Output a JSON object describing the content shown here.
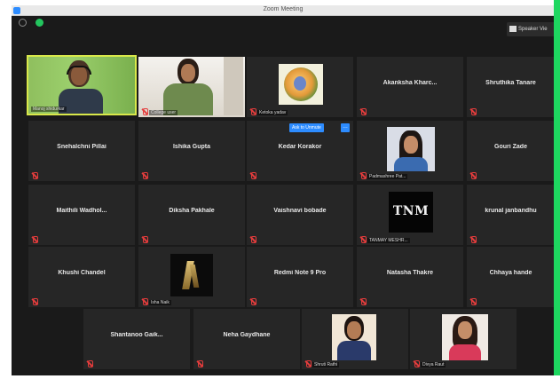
{
  "window": {
    "title": "Zoom Meeting"
  },
  "toolbar": {
    "speaker_view_label": "Speaker Vie"
  },
  "kedar_tile_buttons": {
    "pin_label": "Ask to Unmute",
    "more_label": "…"
  },
  "participants": {
    "r1": [
      {
        "label": "Manoj shidurkar"
      },
      {
        "label": "College user"
      },
      {
        "label": "Ketoka yadav"
      },
      {
        "name": "Akanksha Kharc..."
      },
      {
        "name": "Shruthika Tanare"
      }
    ],
    "r2": [
      {
        "name": "Snehalchni Pillai"
      },
      {
        "name": "Ishika Gupta"
      },
      {
        "name": "Kedar Korakor"
      },
      {
        "label": "Padmashree Pat..."
      },
      {
        "name": "Gouri Zade"
      }
    ],
    "r3": [
      {
        "name": "Maithili Wadhol..."
      },
      {
        "name": "Diksha Pakhale"
      },
      {
        "name": "Vaishnavi bobade"
      },
      {
        "label": "TANMAY MESHR..."
      },
      {
        "name": "krunal janbandhu"
      }
    ],
    "r4": [
      {
        "name": "Khushi Chandel"
      },
      {
        "label": "Isha Naik"
      },
      {
        "name": "Redmi Note 9 Pro"
      },
      {
        "name": "Natasha Thakre"
      },
      {
        "name": "Chhaya hande"
      }
    ],
    "r5": [
      {
        "name": "Shantanoo Gaik..."
      },
      {
        "name": "Neha Gaydhane"
      },
      {
        "label": "Shruti Rathi"
      },
      {
        "label": "Divya Raut"
      }
    ]
  }
}
